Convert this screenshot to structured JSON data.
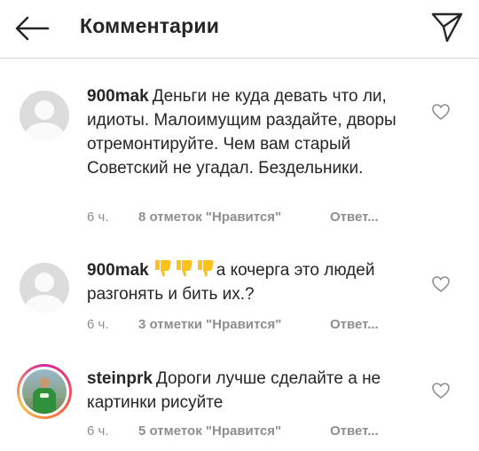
{
  "header": {
    "title": "Комментарии",
    "back_icon": "arrow-left-icon",
    "send_icon": "paper-plane-icon"
  },
  "colors": {
    "text": "#262626",
    "muted": "#8e8e8e",
    "divider": "#dbdbdb",
    "emoji_yellow": "#fcc21b",
    "story_ring": "#d6249f"
  },
  "comments": [
    {
      "username": "900mak",
      "text": "Деньги не куда девать что ли, идиоты. Малоимущим раздайте, дворы отремонтируйте. Чем вам старый Советский не угадал. Бездельники.",
      "emojis": "",
      "time": "6 ч.",
      "likes": "8 отметок \"Нравится\"",
      "reply": "Ответ...",
      "avatar": "default-avatar-icon"
    },
    {
      "username": "900mak",
      "text": "а кочерга это людей разгонять и бить их.?",
      "emojis": "👎👎👎",
      "time": "6 ч.",
      "likes": "3 отметки \"Нравится\"",
      "reply": "Ответ...",
      "avatar": "default-avatar-icon"
    },
    {
      "username": "steinprk",
      "text": "Дороги лучше сделайте а не картинки рисуйте",
      "emojis": "",
      "time": "6 ч.",
      "likes": "5 отметок \"Нравится\"",
      "reply": "Ответ...",
      "avatar": "profile-photo"
    }
  ]
}
